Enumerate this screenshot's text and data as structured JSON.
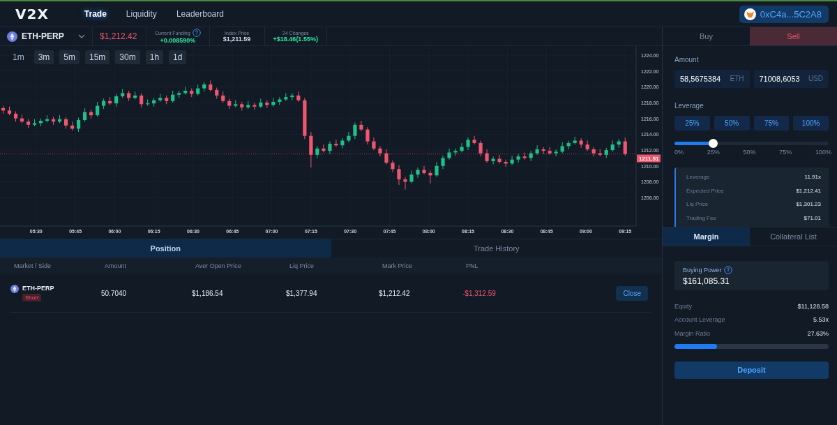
{
  "nav": {
    "logo": "V2X",
    "tabs": [
      {
        "label": "Trade",
        "selected": true
      },
      {
        "label": "Liquidity",
        "selected": false
      },
      {
        "label": "Leaderboard",
        "selected": false
      }
    ],
    "wallet": "0xC4a...5C2A8"
  },
  "market": {
    "symbol": "ETH-PERP",
    "price": "$1,212.42",
    "stats": [
      {
        "label": "Current Funding",
        "value": "+0.008590%",
        "color": "#2ee8a0",
        "help": true
      },
      {
        "label": "Index Price",
        "value": "$1,211.59",
        "color": "#d6dce6",
        "help": false
      },
      {
        "label": "24 Changes",
        "value": "+$18.46(1.55%)",
        "color": "#2ee8a0",
        "help": false
      }
    ]
  },
  "timeframes": [
    {
      "label": "1m",
      "selected": true
    },
    {
      "label": "3m",
      "selected": false
    },
    {
      "label": "5m",
      "selected": false
    },
    {
      "label": "15m",
      "selected": false
    },
    {
      "label": "30m",
      "selected": false
    },
    {
      "label": "1h",
      "selected": false
    },
    {
      "label": "1d",
      "selected": false
    }
  ],
  "chart": {
    "chart_data": {
      "type": "candlestick",
      "grid": true,
      "xlim": [
        5.27,
        9.32
      ],
      "ylim": [
        1202.39,
        1225.15
      ],
      "ref_lines": [
        {
          "axis": "y",
          "value": 1211.51,
          "label": "1211.51"
        }
      ],
      "yticks": [
        {
          "value": 1224,
          "label": "1224.00"
        },
        {
          "value": 1222,
          "label": "1222.00"
        },
        {
          "value": 1220,
          "label": "1220.00"
        },
        {
          "value": 1218,
          "label": "1218.00"
        },
        {
          "value": 1216,
          "label": "1216.00"
        },
        {
          "value": 1214,
          "label": "1214.00"
        },
        {
          "value": 1212,
          "label": "1212.00"
        },
        {
          "value": 1210,
          "label": "1210.00"
        },
        {
          "value": 1208,
          "label": "1208.00"
        },
        {
          "value": 1206,
          "label": "1206.00"
        }
      ],
      "xticks": [
        {
          "value": 5.5,
          "label": "05:30"
        },
        {
          "value": 5.75,
          "label": "05:45"
        },
        {
          "value": 6,
          "label": "06:00"
        },
        {
          "value": 6.25,
          "label": "06:15"
        },
        {
          "value": 6.5,
          "label": "06:30"
        },
        {
          "value": 6.75,
          "label": "06:45"
        },
        {
          "value": 7,
          "label": "07:00"
        },
        {
          "value": 7.25,
          "label": "07:15"
        },
        {
          "value": 7.5,
          "label": "07:30"
        },
        {
          "value": 7.75,
          "label": "07:45"
        },
        {
          "value": 8,
          "label": "08:00"
        },
        {
          "value": 8.25,
          "label": "08:15"
        },
        {
          "value": 8.5,
          "label": "08:30"
        },
        {
          "value": 8.75,
          "label": "08:45"
        },
        {
          "value": 9,
          "label": "09:00"
        },
        {
          "value": 9.25,
          "label": "09:15"
        }
      ],
      "x": [
        5.29,
        5.33,
        5.37,
        5.41,
        5.45,
        5.49,
        5.53,
        5.57,
        5.61,
        5.65,
        5.69,
        5.73,
        5.77,
        5.81,
        5.85,
        5.89,
        5.93,
        5.97,
        6.01,
        6.05,
        6.09,
        6.13,
        6.17,
        6.21,
        6.25,
        6.29,
        6.33,
        6.37,
        6.41,
        6.45,
        6.49,
        6.53,
        6.57,
        6.61,
        6.65,
        6.69,
        6.73,
        6.77,
        6.81,
        6.85,
        6.89,
        6.93,
        6.97,
        7.01,
        7.05,
        7.09,
        7.13,
        7.17,
        7.21,
        7.25,
        7.29,
        7.33,
        7.37,
        7.41,
        7.45,
        7.49,
        7.53,
        7.57,
        7.61,
        7.65,
        7.69,
        7.73,
        7.77,
        7.81,
        7.85,
        7.89,
        7.93,
        7.97,
        8.01,
        8.05,
        8.09,
        8.13,
        8.17,
        8.21,
        8.25,
        8.29,
        8.33,
        8.37,
        8.41,
        8.45,
        8.49,
        8.53,
        8.57,
        8.61,
        8.65,
        8.69,
        8.73,
        8.77,
        8.81,
        8.85,
        8.89,
        8.93,
        8.97,
        9.01,
        9.05,
        9.09,
        9.13,
        9.17,
        9.21,
        9.25
      ],
      "ohlc": [
        [
          1217.3,
          1217.6,
          1216.6,
          1217.0
        ],
        [
          1217.0,
          1217.5,
          1216.4,
          1216.6
        ],
        [
          1216.6,
          1216.9,
          1215.6,
          1216.0
        ],
        [
          1216.0,
          1216.5,
          1215.4,
          1215.6
        ],
        [
          1215.6,
          1215.9,
          1214.8,
          1215.2
        ],
        [
          1215.2,
          1215.9,
          1215.0,
          1215.4
        ],
        [
          1215.4,
          1216.0,
          1215.0,
          1215.7
        ],
        [
          1215.7,
          1216.4,
          1215.5,
          1215.9
        ],
        [
          1215.9,
          1216.2,
          1215.2,
          1215.6
        ],
        [
          1215.6,
          1216.4,
          1215.4,
          1215.9
        ],
        [
          1215.9,
          1216.2,
          1214.7,
          1215.1
        ],
        [
          1215.1,
          1215.6,
          1214.5,
          1214.7
        ],
        [
          1214.7,
          1216.1,
          1214.3,
          1215.8
        ],
        [
          1215.8,
          1217.3,
          1215.6,
          1216.8
        ],
        [
          1216.8,
          1217.1,
          1216.0,
          1216.4
        ],
        [
          1216.4,
          1218.1,
          1216.2,
          1217.6
        ],
        [
          1217.6,
          1218.5,
          1217.2,
          1218.2
        ],
        [
          1218.2,
          1218.7,
          1217.7,
          1217.9
        ],
        [
          1217.9,
          1219.1,
          1217.5,
          1218.8
        ],
        [
          1218.8,
          1219.7,
          1218.6,
          1219.2
        ],
        [
          1219.2,
          1219.5,
          1218.2,
          1218.6
        ],
        [
          1218.6,
          1219.4,
          1218.4,
          1218.9
        ],
        [
          1218.9,
          1219.2,
          1217.4,
          1217.8
        ],
        [
          1217.8,
          1218.4,
          1217.6,
          1217.9
        ],
        [
          1217.9,
          1218.6,
          1217.5,
          1218.3
        ],
        [
          1218.3,
          1219.1,
          1218.1,
          1218.6
        ],
        [
          1218.6,
          1218.9,
          1217.8,
          1218.2
        ],
        [
          1218.2,
          1219.5,
          1218.0,
          1219.0
        ],
        [
          1219.0,
          1219.5,
          1218.6,
          1219.2
        ],
        [
          1219.2,
          1220.0,
          1219.0,
          1219.5
        ],
        [
          1219.5,
          1219.8,
          1218.7,
          1219.1
        ],
        [
          1219.1,
          1220.3,
          1218.9,
          1219.8
        ],
        [
          1219.8,
          1220.6,
          1219.4,
          1220.3
        ],
        [
          1220.3,
          1220.8,
          1219.4,
          1219.6
        ],
        [
          1219.6,
          1219.9,
          1218.5,
          1218.9
        ],
        [
          1218.9,
          1219.4,
          1218.0,
          1218.2
        ],
        [
          1218.2,
          1218.5,
          1217.2,
          1217.6
        ],
        [
          1217.6,
          1218.3,
          1217.4,
          1217.8
        ],
        [
          1217.8,
          1218.1,
          1217.0,
          1217.4
        ],
        [
          1217.4,
          1218.2,
          1217.2,
          1217.7
        ],
        [
          1217.7,
          1218.0,
          1217.1,
          1217.5
        ],
        [
          1217.5,
          1218.5,
          1217.3,
          1218.0
        ],
        [
          1218.0,
          1218.3,
          1217.3,
          1217.7
        ],
        [
          1217.7,
          1218.6,
          1217.5,
          1218.1
        ],
        [
          1218.1,
          1218.7,
          1217.7,
          1218.4
        ],
        [
          1218.4,
          1219.2,
          1218.2,
          1218.7
        ],
        [
          1218.7,
          1219.2,
          1218.3,
          1218.9
        ],
        [
          1218.9,
          1219.4,
          1218.1,
          1218.3
        ],
        [
          1218.3,
          1218.6,
          1213.4,
          1213.8
        ],
        [
          1213.8,
          1214.3,
          1209.8,
          1211.4
        ],
        [
          1211.4,
          1212.5,
          1211.0,
          1212.2
        ],
        [
          1212.2,
          1212.7,
          1211.7,
          1211.9
        ],
        [
          1211.9,
          1213.1,
          1211.5,
          1212.8
        ],
        [
          1212.8,
          1213.3,
          1212.4,
          1212.6
        ],
        [
          1212.6,
          1213.5,
          1212.2,
          1213.2
        ],
        [
          1213.2,
          1214.3,
          1213.0,
          1213.8
        ],
        [
          1213.8,
          1215.5,
          1213.4,
          1215.2
        ],
        [
          1215.2,
          1215.7,
          1214.4,
          1214.6
        ],
        [
          1214.6,
          1214.9,
          1212.7,
          1213.1
        ],
        [
          1213.1,
          1213.6,
          1212.0,
          1212.2
        ],
        [
          1212.2,
          1212.5,
          1211.2,
          1211.6
        ],
        [
          1211.6,
          1212.1,
          1210.2,
          1210.4
        ],
        [
          1210.4,
          1210.7,
          1209.2,
          1209.6
        ],
        [
          1209.6,
          1210.1,
          1207.6,
          1208.3
        ],
        [
          1208.3,
          1208.6,
          1207.0,
          1208.0
        ],
        [
          1208.0,
          1209.4,
          1207.8,
          1208.9
        ],
        [
          1208.9,
          1209.8,
          1208.5,
          1209.5
        ],
        [
          1209.5,
          1210.0,
          1208.9,
          1209.1
        ],
        [
          1209.1,
          1209.4,
          1207.8,
          1208.8
        ],
        [
          1208.8,
          1210.5,
          1208.6,
          1210.0
        ],
        [
          1210.0,
          1211.3,
          1209.6,
          1211.0
        ],
        [
          1211.0,
          1212.2,
          1210.8,
          1211.7
        ],
        [
          1211.7,
          1212.2,
          1211.3,
          1211.9
        ],
        [
          1211.9,
          1212.9,
          1211.7,
          1212.4
        ],
        [
          1212.4,
          1213.6,
          1212.0,
          1213.3
        ],
        [
          1213.3,
          1213.8,
          1212.7,
          1212.9
        ],
        [
          1212.9,
          1213.2,
          1211.2,
          1211.6
        ],
        [
          1211.6,
          1212.1,
          1210.4,
          1210.6
        ],
        [
          1210.6,
          1211.2,
          1210.2,
          1210.9
        ],
        [
          1210.9,
          1211.4,
          1210.3,
          1210.5
        ],
        [
          1210.5,
          1210.8,
          1209.9,
          1210.3
        ],
        [
          1210.3,
          1211.3,
          1210.1,
          1210.8
        ],
        [
          1210.8,
          1211.5,
          1210.4,
          1211.2
        ],
        [
          1211.2,
          1211.7,
          1210.8,
          1211.0
        ],
        [
          1211.0,
          1211.9,
          1210.6,
          1211.6
        ],
        [
          1211.6,
          1212.6,
          1211.4,
          1212.1
        ],
        [
          1212.1,
          1212.4,
          1211.5,
          1211.9
        ],
        [
          1211.9,
          1212.4,
          1211.4,
          1211.6
        ],
        [
          1211.6,
          1212.1,
          1211.2,
          1211.8
        ],
        [
          1211.8,
          1213.0,
          1211.6,
          1212.5
        ],
        [
          1212.5,
          1213.2,
          1212.1,
          1212.9
        ],
        [
          1212.9,
          1213.7,
          1212.7,
          1213.2
        ],
        [
          1213.2,
          1213.5,
          1212.3,
          1212.7
        ],
        [
          1212.7,
          1213.2,
          1211.9,
          1212.1
        ],
        [
          1212.1,
          1212.4,
          1211.2,
          1211.6
        ],
        [
          1211.6,
          1212.1,
          1211.2,
          1211.4
        ],
        [
          1211.4,
          1212.3,
          1211.0,
          1212.0
        ],
        [
          1212.0,
          1213.2,
          1211.8,
          1212.7
        ],
        [
          1212.7,
          1213.4,
          1212.3,
          1213.1
        ],
        [
          1213.1,
          1213.6,
          1211.3,
          1211.5
        ]
      ]
    }
  },
  "positions": {
    "tabs": [
      {
        "label": "Position",
        "selected": true
      },
      {
        "label": "Trade History",
        "selected": false
      }
    ],
    "columns": [
      "Market / Side",
      "Amount",
      "Aver Open Price",
      "Liq Price",
      "Mark Price",
      "PNL"
    ],
    "rows": [
      {
        "market": "ETH-PERP",
        "side": "Short",
        "amount": "50.7040",
        "open_price": "$1,186.54",
        "liq_price": "$1,377.94",
        "mark_price": "$1,212.42",
        "pnl": "-$1,312.59",
        "action": "Close"
      }
    ]
  },
  "order": {
    "sides": [
      {
        "label": "Buy",
        "selected": false
      },
      {
        "label": "Sell",
        "selected": true
      }
    ],
    "amount_label": "Amount",
    "inputs": [
      {
        "value": "58,5675384",
        "unit": "ETH"
      },
      {
        "value": "71008,6053",
        "unit": "USD"
      }
    ],
    "leverage_label": "Leverage",
    "presets": [
      "25%",
      "50%",
      "75%",
      "100%"
    ],
    "level": 0.25,
    "scale": [
      "0%",
      "25%",
      "50%",
      "75%",
      "100%"
    ],
    "summary": [
      {
        "label": "Leverage",
        "value": "11.91x"
      },
      {
        "label": "Expected Price",
        "value": "$1,212.41"
      },
      {
        "label": "Liq Price",
        "value": "$1,301.23"
      },
      {
        "label": "Trading Fee",
        "value": "$71.01"
      }
    ]
  },
  "account": {
    "tabs": [
      {
        "label": "Margin",
        "selected": true
      },
      {
        "label": "Collateral List",
        "selected": false
      }
    ],
    "buying_power_label": "Buying Power",
    "buying_power": "$161,085.31",
    "stats": [
      {
        "label": "Equity",
        "value": "$11,128.58"
      },
      {
        "label": "Account Leverage",
        "value": "5.53x"
      },
      {
        "label": "Margin Ratio",
        "value": "27.63%"
      }
    ],
    "margin_bar": {
      "level": 0.2763
    },
    "deposit": "Deposit"
  }
}
